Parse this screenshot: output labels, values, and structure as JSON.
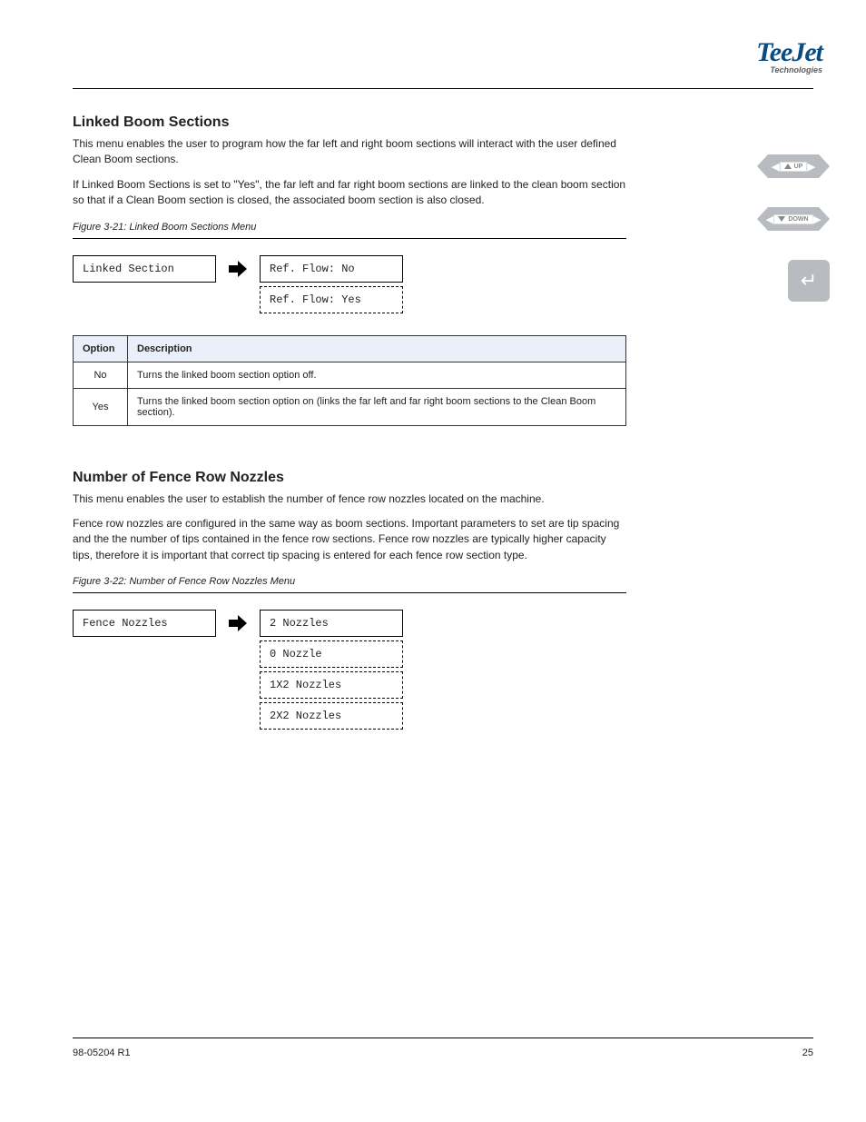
{
  "logo": {
    "main": "TeeJet",
    "sub": "Technologies"
  },
  "nav": {
    "up": "UP",
    "down": "DOWN"
  },
  "section1": {
    "title": "Linked Boom Sections",
    "p1": "This menu enables the user to program how the far left and right boom sections will interact with the user defined Clean Boom sections.",
    "p2": "If Linked Boom Sections is set to \"Yes\", the far left and far right boom sections are linked to the clean boom section so that if a Clean Boom section is closed, the associated boom section is also closed.",
    "fig_caption": "Figure 3-21: Linked Boom Sections Menu",
    "d1": "Linked Section",
    "d2": "Ref. Flow: No",
    "d3": "Ref. Flow: Yes",
    "table": {
      "h1": "Option",
      "h2": "Description",
      "rows": [
        {
          "opt": "No",
          "desc": "Turns the linked boom section option off."
        },
        {
          "opt": "Yes",
          "desc": "Turns the linked boom section option on (links the far left and far right boom sections to the Clean Boom section)."
        }
      ]
    }
  },
  "section2": {
    "title": "Number of Fence Row Nozzles",
    "p1": "This menu enables the user to establish the number of fence row nozzles located on the machine.",
    "p2": "Fence row nozzles are configured in the same way as boom sections. Important parameters to set are tip spacing and the the number of tips contained in the fence row sections. Fence row nozzles are typically higher capacity tips, therefore it is important that correct tip spacing is entered for each fence row section type.",
    "fig_caption": "Figure 3-22: Number of Fence Row Nozzles Menu",
    "d1": "Fence Nozzles",
    "d2": "2 Nozzles",
    "d3": "0 Nozzle",
    "d4": "1X2 Nozzles",
    "d5": "2X2 Nozzles"
  },
  "footer": {
    "left": "98-05204 R1",
    "right": "25"
  }
}
